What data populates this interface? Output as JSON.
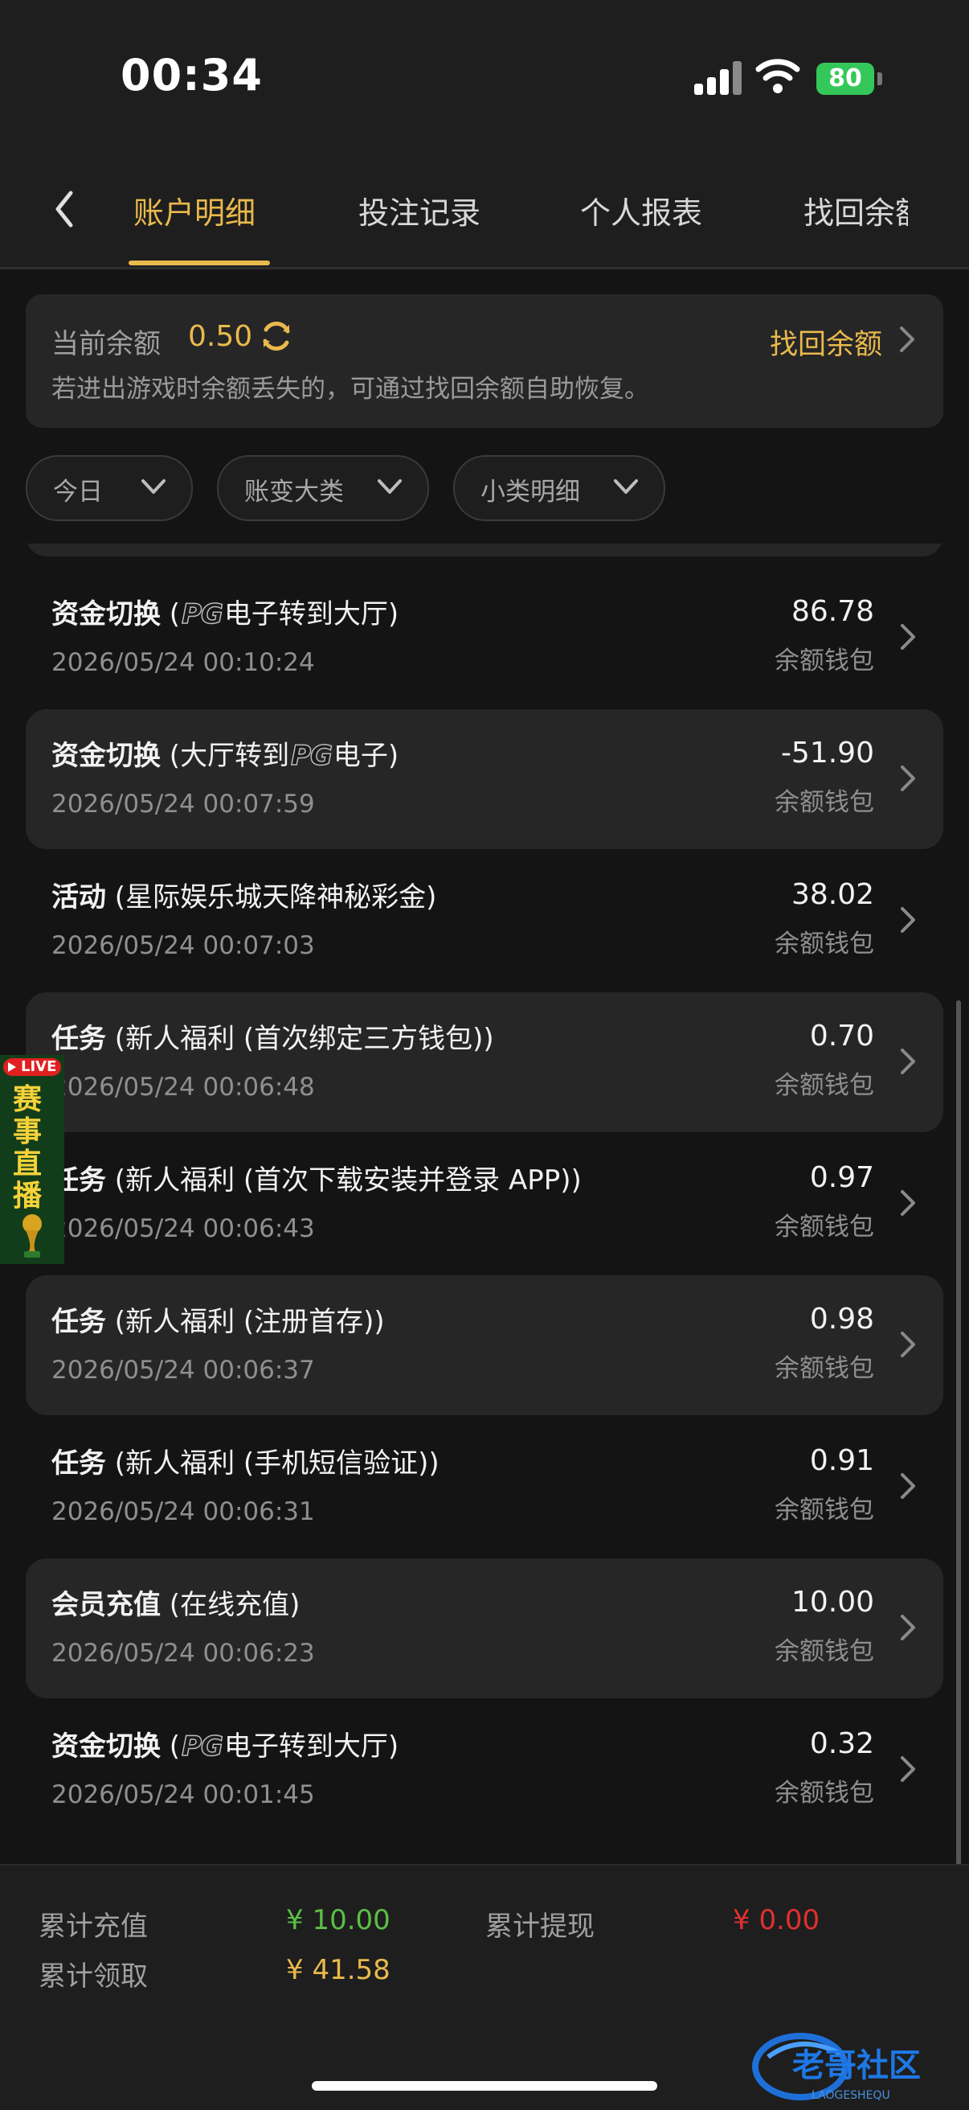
{
  "status": {
    "time": "00:34",
    "battery": "80"
  },
  "nav": {
    "tabs": [
      "账户明细",
      "投注记录",
      "个人报表",
      "找回余额"
    ],
    "active_index": 0
  },
  "balance": {
    "label": "当前余额",
    "value": "0.50",
    "note": "若进出游戏时余额丢失的，可通过找回余额自助恢复。",
    "recover_label": "找回余额"
  },
  "filters": [
    "今日",
    "账变大类",
    "小类明细"
  ],
  "records": [
    {
      "type": "资金切换",
      "detail_pre": " (",
      "pg": "PG",
      "detail_post": "电子转到大厅)",
      "date": "2026/05/24 00:10:24",
      "amount": "86.78",
      "wallet": "余额钱包"
    },
    {
      "type": "资金切换",
      "detail_pre": " (大厅转到",
      "pg": "PG",
      "detail_post": "电子)",
      "date": "2026/05/24 00:07:59",
      "amount": "-51.90",
      "wallet": "余额钱包"
    },
    {
      "type": "活动",
      "detail_pre": " (星际娱乐城天降神秘彩金)",
      "pg": "",
      "detail_post": "",
      "date": "2026/05/24 00:07:03",
      "amount": "38.02",
      "wallet": "余额钱包"
    },
    {
      "type": "任务",
      "detail_pre": " (新人福利 (首次绑定三方钱包))",
      "pg": "",
      "detail_post": "",
      "date": "2026/05/24 00:06:48",
      "amount": "0.70",
      "wallet": "余额钱包"
    },
    {
      "type": "任务",
      "detail_pre": " (新人福利 (首次下载安装并登录 APP))",
      "pg": "",
      "detail_post": "",
      "date": "2026/05/24 00:06:43",
      "amount": "0.97",
      "wallet": "余额钱包"
    },
    {
      "type": "任务",
      "detail_pre": " (新人福利 (注册首存))",
      "pg": "",
      "detail_post": "",
      "date": "2026/05/24 00:06:37",
      "amount": "0.98",
      "wallet": "余额钱包"
    },
    {
      "type": "任务",
      "detail_pre": " (新人福利 (手机短信验证))",
      "pg": "",
      "detail_post": "",
      "date": "2026/05/24 00:06:31",
      "amount": "0.91",
      "wallet": "余额钱包"
    },
    {
      "type": "会员充值",
      "detail_pre": " (在线充值)",
      "pg": "",
      "detail_post": "",
      "date": "2026/05/24 00:06:23",
      "amount": "10.00",
      "wallet": "余额钱包"
    },
    {
      "type": "资金切换",
      "detail_pre": " (",
      "pg": "PG",
      "detail_post": "电子转到大厅)",
      "date": "2026/05/24 00:01:45",
      "amount": "0.32",
      "wallet": "余额钱包"
    }
  ],
  "live_badge": {
    "tag": "LIVE",
    "text": "赛事直播"
  },
  "footer": {
    "recharge_label": "累计充值",
    "recharge_value": "¥ 10.00",
    "withdraw_label": "累计提现",
    "withdraw_value": "¥ 0.00",
    "claim_label": "累计领取",
    "claim_value": "¥ 41.58"
  },
  "watermark": {
    "title": "老哥社区",
    "subtitle": "LAOGESHEQU"
  },
  "colors": {
    "accent": "#e9b94c",
    "green": "#5bbf45",
    "red": "#e03030",
    "background": "#141414",
    "card": "#262626"
  }
}
